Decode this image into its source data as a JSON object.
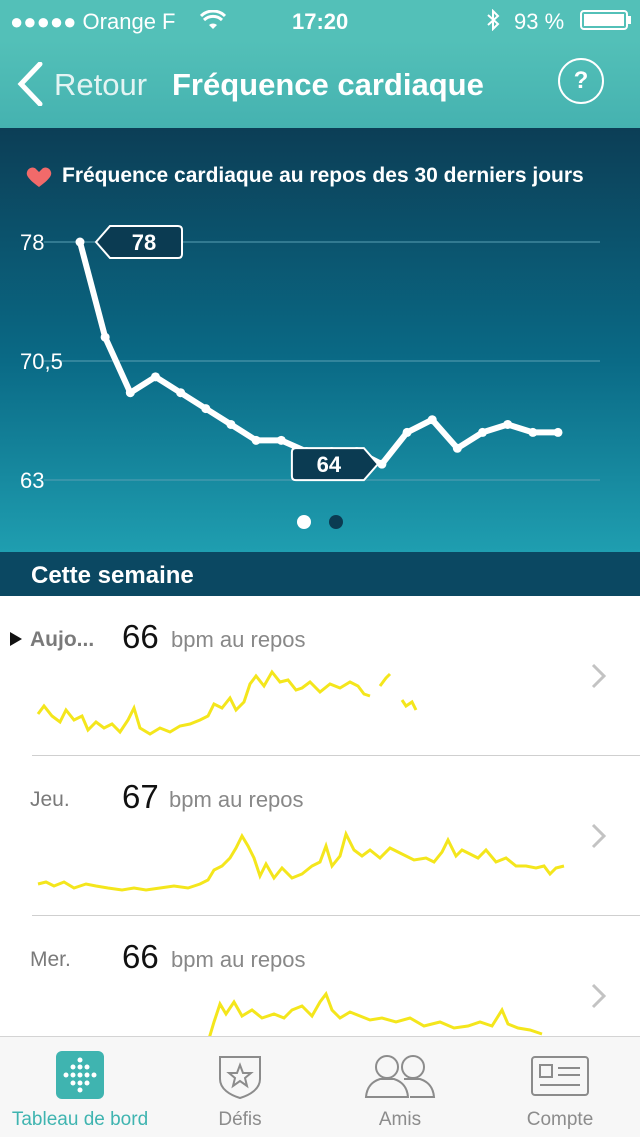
{
  "status_bar": {
    "carrier": "●●●●● Orange F",
    "time": "17:20",
    "battery": "93 %"
  },
  "nav": {
    "back_label": "Retour",
    "title": "Fréquence cardiaque",
    "help_label": "?"
  },
  "chart_data": {
    "type": "line",
    "title": "Fréquence cardiaque au repos des 30 derniers jours",
    "y_ticks": [
      "78",
      "70,5",
      "63"
    ],
    "ylim": [
      63,
      78
    ],
    "x": [
      1,
      2,
      3,
      4,
      5,
      6,
      7,
      8,
      9,
      10,
      11,
      12,
      13,
      14,
      15,
      16,
      17,
      18,
      19,
      20,
      21,
      22,
      23,
      24,
      25,
      26,
      27,
      28,
      29,
      30
    ],
    "values": [
      78,
      72,
      68.5,
      69.5,
      68.5,
      67.5,
      66.5,
      65.5,
      65.5,
      64.8,
      64.8,
      64.8,
      64,
      66,
      66.8,
      65,
      66,
      66.5,
      66,
      66
    ],
    "max_label": "78",
    "min_label": "64",
    "grid": true,
    "colors": {
      "line": "#ffffff",
      "grid": "#5aa0b4"
    },
    "page_dots": 2,
    "active_page": 0
  },
  "section": {
    "title": "Cette semaine"
  },
  "days": [
    {
      "label": "Aujo...",
      "value": "66",
      "unit": "bpm au repos",
      "current": true
    },
    {
      "label": "Jeu.",
      "value": "67",
      "unit": "bpm au repos",
      "current": false
    },
    {
      "label": "Mer.",
      "value": "66",
      "unit": "bpm au repos",
      "current": false
    }
  ],
  "tabbar": {
    "items": [
      {
        "label": "Tableau de bord",
        "icon": "dashboard-icon",
        "active": true
      },
      {
        "label": "Défis",
        "icon": "challenges-icon",
        "active": false
      },
      {
        "label": "Amis",
        "icon": "friends-icon",
        "active": false
      },
      {
        "label": "Compte",
        "icon": "account-icon",
        "active": false
      }
    ]
  },
  "colors": {
    "teal": "#53c0b8",
    "accent": "#3fb4b0",
    "sparkline": "#f4e61c",
    "heart": "#f16a6a"
  }
}
